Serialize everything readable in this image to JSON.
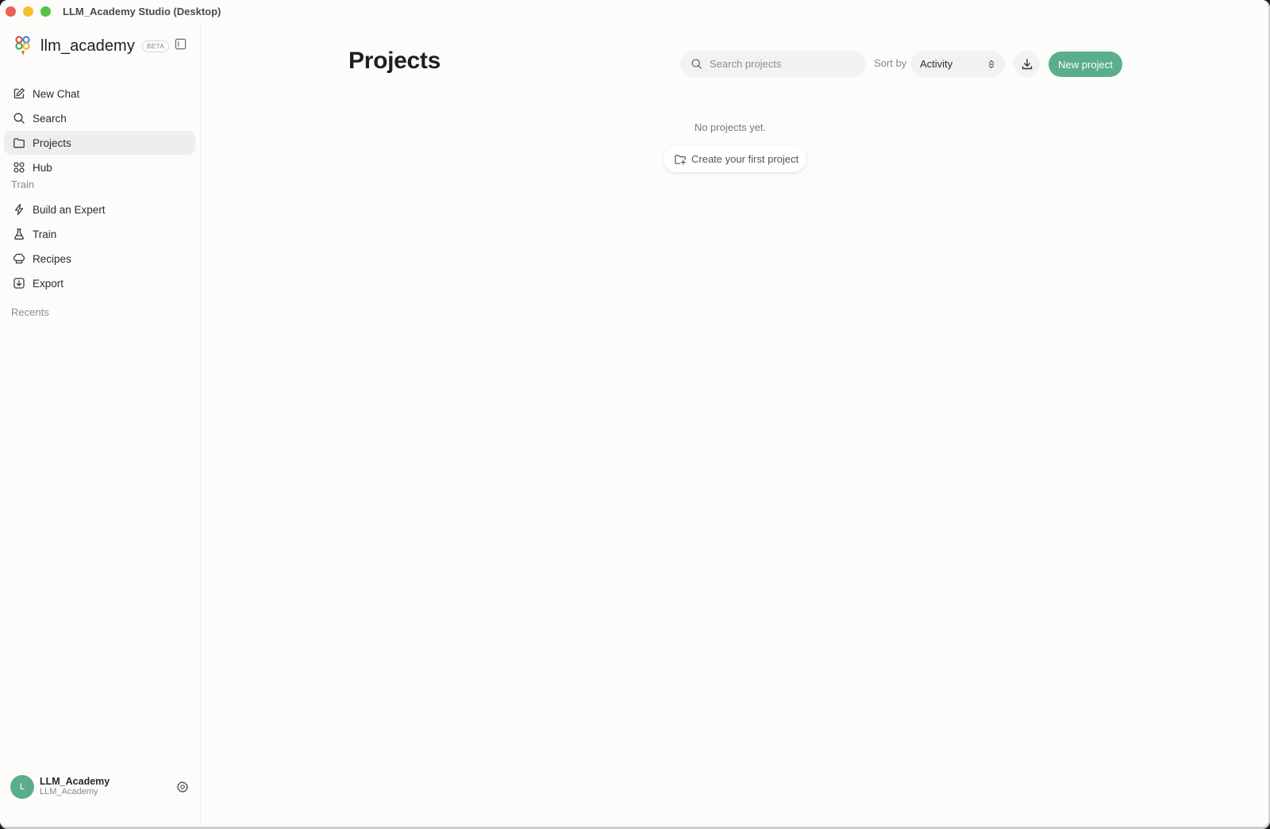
{
  "window": {
    "title": "LLM_Academy Studio (Desktop)"
  },
  "brand": {
    "name": "llm_academy",
    "badge": "BETA"
  },
  "nav": {
    "items": [
      {
        "label": "New Chat",
        "icon": "edit-icon"
      },
      {
        "label": "Search",
        "icon": "search-icon"
      },
      {
        "label": "Projects",
        "icon": "folder-icon",
        "active": true
      },
      {
        "label": "Hub",
        "icon": "grid-icon"
      }
    ]
  },
  "train": {
    "label": "Train",
    "items": [
      {
        "label": "Build an Expert",
        "icon": "bolt-icon"
      },
      {
        "label": "Train",
        "icon": "flask-icon"
      },
      {
        "label": "Recipes",
        "icon": "chef-hat-icon"
      },
      {
        "label": "Export",
        "icon": "export-icon"
      }
    ]
  },
  "recents": {
    "label": "Recents"
  },
  "user": {
    "initial": "L",
    "name": "LLM_Academy",
    "subtitle": "LLM_Academy"
  },
  "main": {
    "title": "Projects",
    "search": {
      "placeholder": "Search projects",
      "value": ""
    },
    "sort": {
      "label": "Sort by",
      "value": "Activity"
    },
    "new_project_label": "New project",
    "empty": {
      "message": "No projects yet.",
      "cta": "Create your first project"
    }
  },
  "colors": {
    "accent": "#5aae8b",
    "active_nav": "#eeeeed"
  }
}
